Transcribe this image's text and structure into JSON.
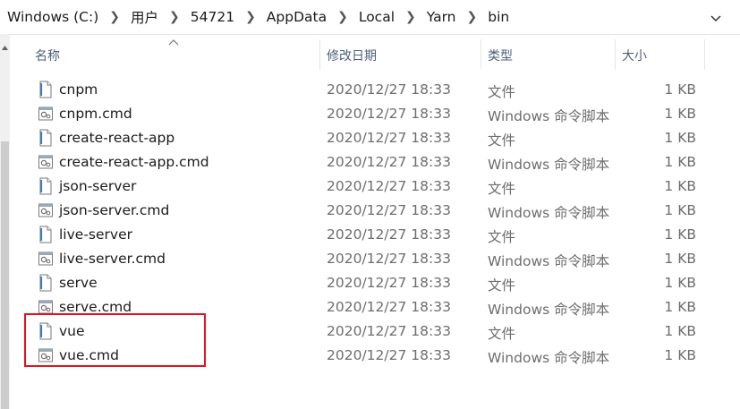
{
  "breadcrumb": [
    "Windows (C:)",
    "用户",
    "54721",
    "AppData",
    "Local",
    "Yarn",
    "bin"
  ],
  "columns": {
    "name": "名称",
    "date": "修改日期",
    "type": "类型",
    "size": "大小"
  },
  "files": [
    {
      "name": "cnpm",
      "date": "2020/12/27 18:33",
      "type": "文件",
      "size": "1 KB",
      "icon": "file-icon"
    },
    {
      "name": "cnpm.cmd",
      "date": "2020/12/27 18:33",
      "type": "Windows 命令脚本",
      "size": "1 KB",
      "icon": "cmd-script-icon"
    },
    {
      "name": "create-react-app",
      "date": "2020/12/27 18:33",
      "type": "文件",
      "size": "1 KB",
      "icon": "file-icon"
    },
    {
      "name": "create-react-app.cmd",
      "date": "2020/12/27 18:33",
      "type": "Windows 命令脚本",
      "size": "1 KB",
      "icon": "cmd-script-icon"
    },
    {
      "name": "json-server",
      "date": "2020/12/27 18:33",
      "type": "文件",
      "size": "1 KB",
      "icon": "file-icon"
    },
    {
      "name": "json-server.cmd",
      "date": "2020/12/27 18:33",
      "type": "Windows 命令脚本",
      "size": "1 KB",
      "icon": "cmd-script-icon"
    },
    {
      "name": "live-server",
      "date": "2020/12/27 18:33",
      "type": "文件",
      "size": "1 KB",
      "icon": "file-icon"
    },
    {
      "name": "live-server.cmd",
      "date": "2020/12/27 18:33",
      "type": "Windows 命令脚本",
      "size": "1 KB",
      "icon": "cmd-script-icon"
    },
    {
      "name": "serve",
      "date": "2020/12/27 18:33",
      "type": "文件",
      "size": "1 KB",
      "icon": "file-icon"
    },
    {
      "name": "serve.cmd",
      "date": "2020/12/27 18:33",
      "type": "Windows 命令脚本",
      "size": "1 KB",
      "icon": "cmd-script-icon"
    },
    {
      "name": "vue",
      "date": "2020/12/27 18:33",
      "type": "文件",
      "size": "1 KB",
      "icon": "file-icon"
    },
    {
      "name": "vue.cmd",
      "date": "2020/12/27 18:33",
      "type": "Windows 命令脚本",
      "size": "1 KB",
      "icon": "cmd-script-icon"
    }
  ],
  "highlight_color": "#e8101e"
}
